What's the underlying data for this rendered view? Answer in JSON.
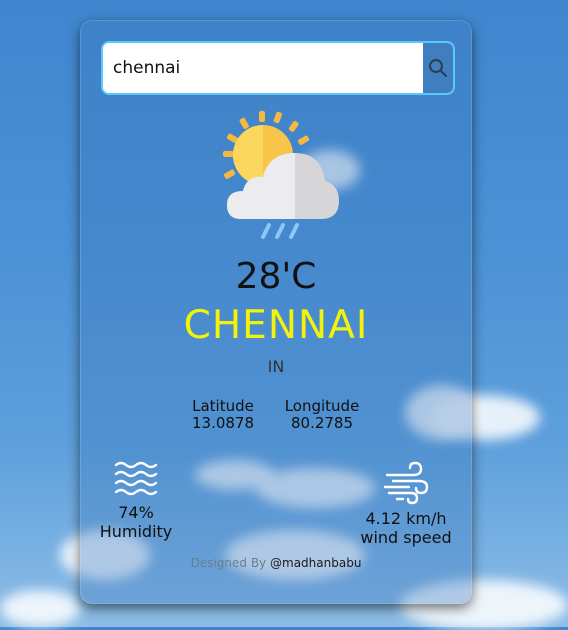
{
  "search": {
    "value": "chennai",
    "icon": "search-icon"
  },
  "weather": {
    "icon": "partly-cloudy-rain-icon",
    "temperature": "28'C",
    "city": "CHENNAI",
    "country": "IN"
  },
  "coordinates": {
    "latitude_label": "Latitude",
    "latitude_value": "13.0878",
    "longitude_label": "Longitude",
    "longitude_value": "80.2785"
  },
  "stats": {
    "humidity_value": "74%",
    "humidity_label": "Humidity",
    "humidity_icon": "waves-icon",
    "wind_value": "4.12 km/h",
    "wind_label": "wind speed",
    "wind_icon": "wind-icon"
  },
  "footer": {
    "prefix": "Designed By",
    "handle": "@madhanbabu"
  },
  "colors": {
    "city": "#f2f20a",
    "search_border": "#5ac8fa"
  }
}
